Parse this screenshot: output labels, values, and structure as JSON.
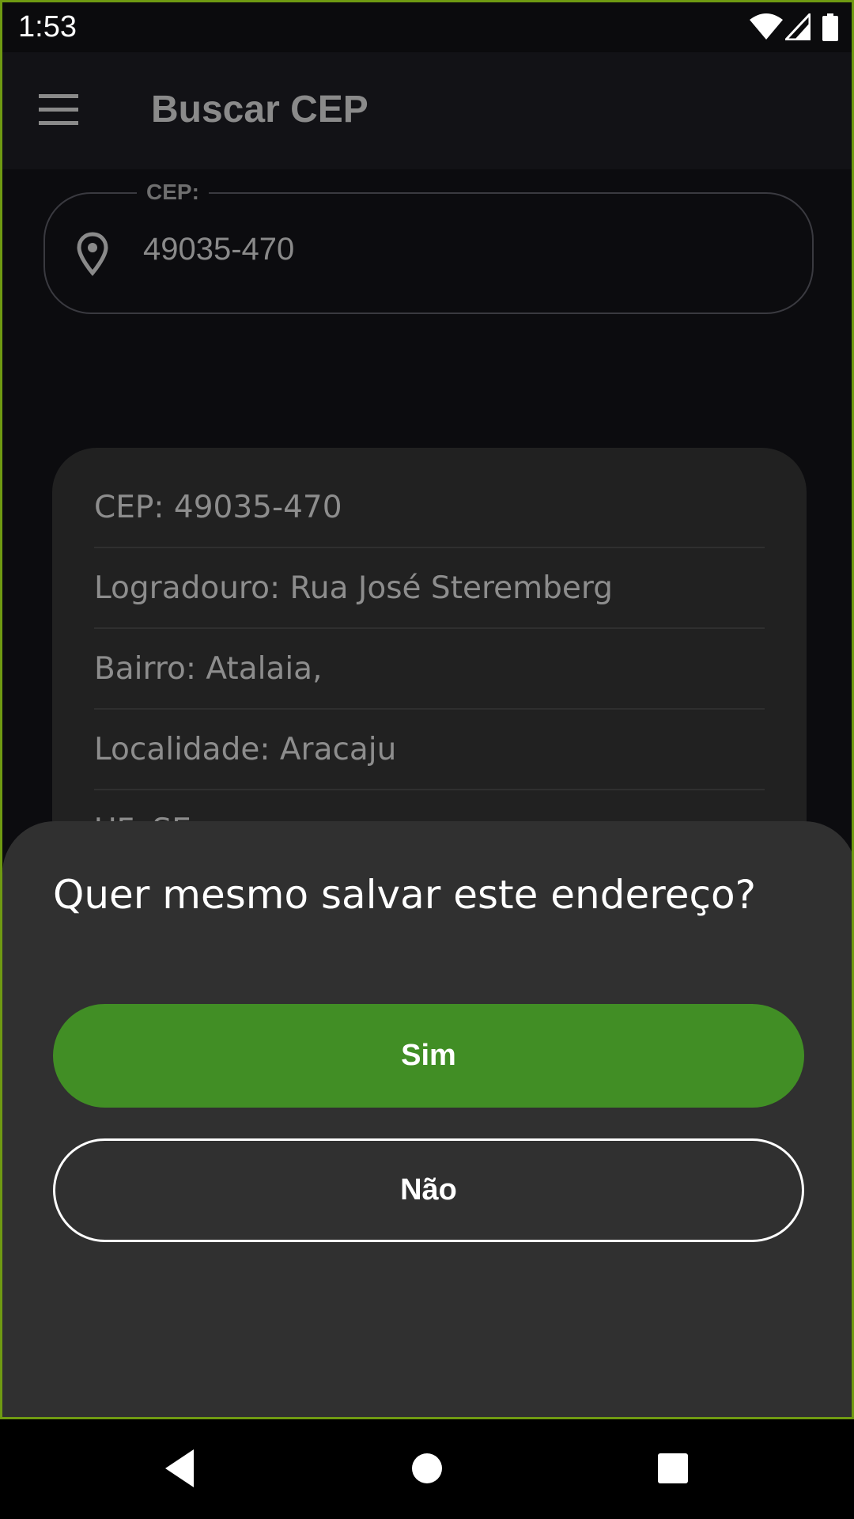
{
  "status_bar": {
    "time": "1:53",
    "icons": [
      "wifi-icon",
      "signal-icon",
      "battery-icon"
    ]
  },
  "toolbar": {
    "menu_icon": "hamburger-menu-icon",
    "title": "Buscar CEP"
  },
  "search": {
    "label": "CEP:",
    "icon": "location-pin-icon",
    "value": "49035-470"
  },
  "result": {
    "rows": [
      "CEP: 49035-470",
      "Logradouro: Rua José Steremberg",
      "Bairro: Atalaia,",
      "Localidade: Aracaju",
      "UF: SE"
    ]
  },
  "dialog": {
    "question": "Quer mesmo salvar este endereço?",
    "yes_label": "Sim",
    "no_label": "Não"
  },
  "nav_bar": {
    "icons": [
      "back-icon",
      "home-icon",
      "recents-icon"
    ]
  },
  "colors": {
    "accent_green": "#418e25",
    "frame_green": "#6f9a12",
    "sheet_bg": "#303030",
    "card_bg": "#212121"
  }
}
